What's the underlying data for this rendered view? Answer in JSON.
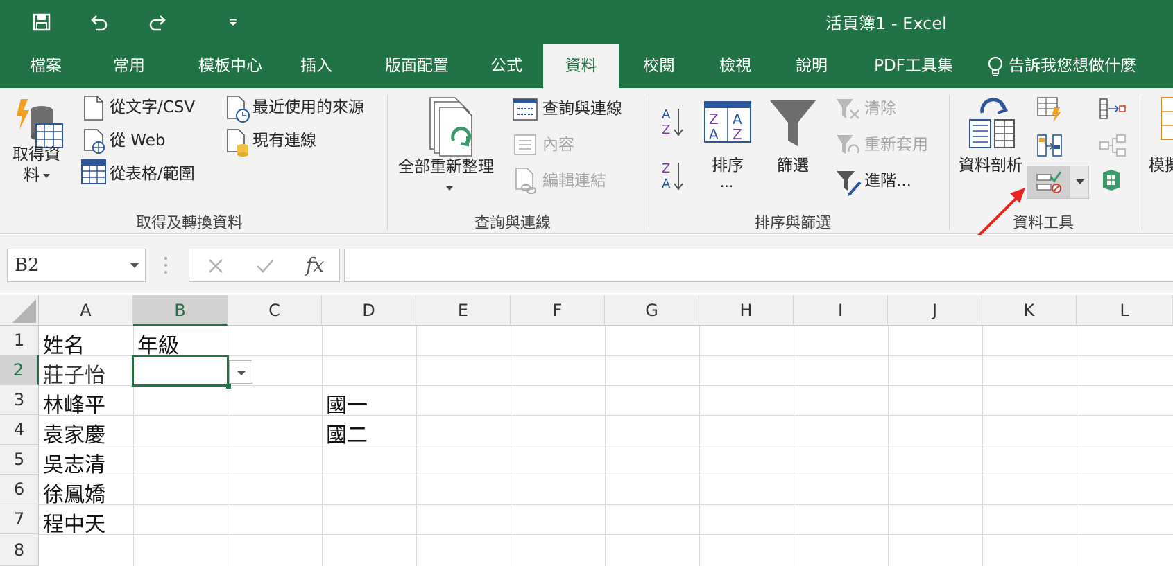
{
  "window": {
    "title": "活頁簿1  -  Excel"
  },
  "quick_access": {
    "save_icon": "save-icon",
    "undo_icon": "undo-icon",
    "redo_icon": "redo-icon",
    "customize_icon": "customize-qat-icon"
  },
  "tabs": [
    {
      "label": "檔案"
    },
    {
      "label": "常用"
    },
    {
      "label": "模板中心"
    },
    {
      "label": "插入"
    },
    {
      "label": "版面配置"
    },
    {
      "label": "公式"
    },
    {
      "label": "資料"
    },
    {
      "label": "校閱"
    },
    {
      "label": "檢視"
    },
    {
      "label": "說明"
    },
    {
      "label": "PDF工具集"
    }
  ],
  "tell_me": "告訴我您想做什麼",
  "ribbon": {
    "get_transform": {
      "label": "取得及轉換資料",
      "get_data_1": "取得資",
      "get_data_2": "料",
      "from_text": "從文字/CSV",
      "from_web": "從 Web",
      "from_table": "從表格/範圍",
      "recent_sources": "最近使用的來源",
      "existing_connections": "現有連線"
    },
    "queries": {
      "label": "查詢與連線",
      "refresh_all": "全部重新整理",
      "queries_connections": "查詢與連線",
      "properties": "內容",
      "edit_links": "編輯連結"
    },
    "sort_filter": {
      "label": "排序與篩選",
      "sort": "排序",
      "sort_more": "...",
      "filter": "篩選",
      "clear": "清除",
      "reapply": "重新套用",
      "advanced": "進階..."
    },
    "data_tools": {
      "label": "資料工具",
      "text_to_columns": "資料剖析",
      "whatif_partial": "模擬"
    }
  },
  "formula_bar": {
    "name_box": "B2",
    "fx": "fx",
    "value": ""
  },
  "columns": [
    "A",
    "B",
    "C",
    "D",
    "E",
    "F",
    "G",
    "H",
    "I",
    "J",
    "K",
    "L"
  ],
  "rows": [
    "1",
    "2",
    "3",
    "4",
    "5",
    "6",
    "7",
    "8"
  ],
  "cells": {
    "A1": "姓名",
    "B1": "年級",
    "A2": "莊子怡",
    "A3": "林峰平",
    "A4": "袁家慶",
    "A5": "吳志清",
    "A6": "徐鳳嬌",
    "A7": "程中天",
    "D3": "國一",
    "D4": "國二"
  },
  "selected_cell": "B2",
  "colors": {
    "excel_green": "#217346",
    "ribbon_bg": "#f3f3f3",
    "annotation_arrow": "#e8251f"
  }
}
